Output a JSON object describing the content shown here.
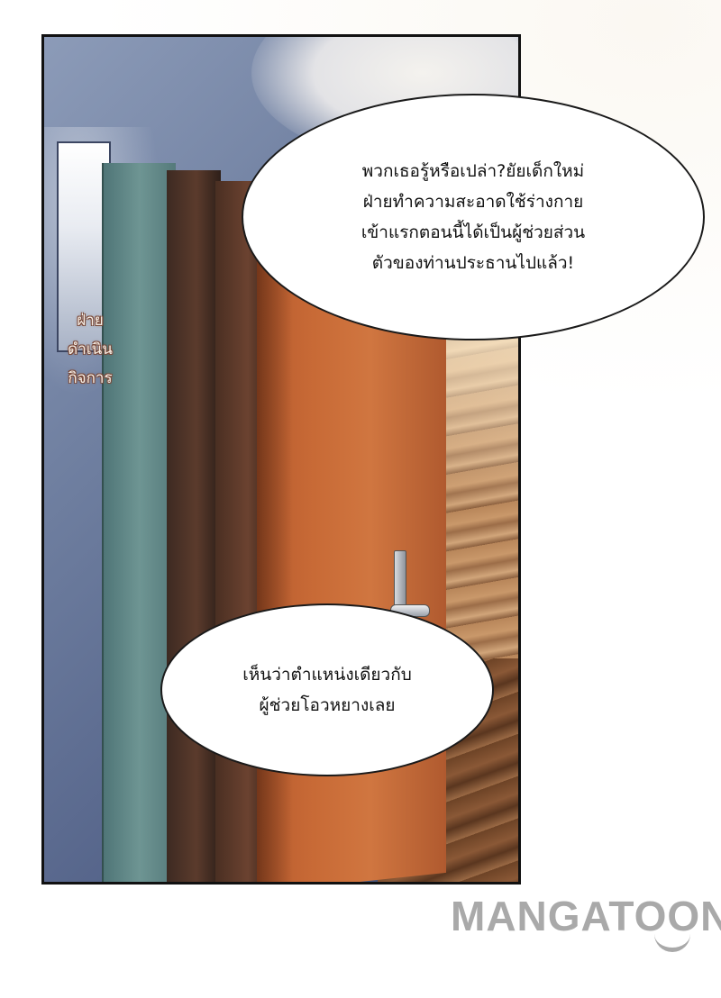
{
  "sfx": {
    "lines": [
      "ฝ่าย",
      "ดำเนิน",
      "กิจการ"
    ]
  },
  "bubbles": {
    "top": {
      "lines": [
        "พวกเธอรู้หรือเปล่า?ยัยเด็กใหม่",
        "ฝ่ายทำความสะอาดใช้ร่างกาย",
        "เข้าแรกตอนนี้ได้เป็นผู้ช่วยส่วน",
        "ตัวของท่านประธานไปแล้ว!"
      ]
    },
    "bottom": {
      "lines": [
        "เห็นว่าตำแหน่งเดียวกับ",
        "ผู้ช่วยโอวหยางเลย"
      ]
    }
  },
  "watermark": {
    "text": "MANGATOON"
  },
  "colors": {
    "door": "#c86a36",
    "wall": "#6f7fa0",
    "frame": "#6e9593",
    "sfx_text": "#f7efe6",
    "watermark": "#a9a9a9"
  }
}
